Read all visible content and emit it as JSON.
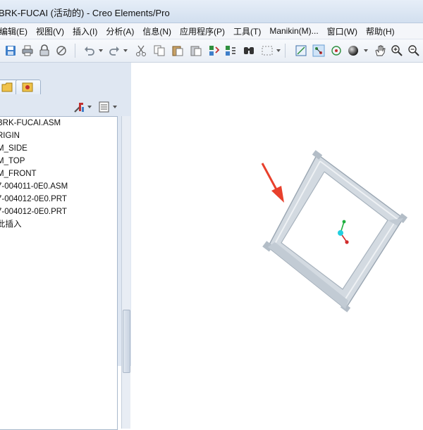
{
  "window": {
    "title": "BRK-FUCAI (活动的) - Creo Elements/Pro"
  },
  "menu": [
    "编辑(E)",
    "视图(V)",
    "插入(I)",
    "分析(A)",
    "信息(N)",
    "应用程序(P)",
    "工具(T)",
    "Manikin(M)...",
    "窗口(W)",
    "帮助(H)"
  ],
  "toolbar": {
    "icons": [
      "save-icon",
      "print-icon",
      "lock-icon",
      "disconnect-icon",
      "undo-icon",
      "redo-icon",
      "cut-icon",
      "copy-icon",
      "paste-icon",
      "paste-special-icon",
      "regenerate-icon",
      "regenerate-manager-icon",
      "find-icon",
      "select-box-icon",
      "repaint-icon",
      "spin-center-icon",
      "orient-icon",
      "shading-icon",
      "pan-hand-icon",
      "zoom-in-icon",
      "zoom-out-icon"
    ]
  },
  "model_tree": {
    "items": [
      "BRK-FUCAI.ASM",
      "RIGIN",
      "M_SIDE",
      "M_TOP",
      "M_FRONT",
      "7-004011-0E0.ASM",
      "7-004012-0E0.PRT",
      "7-004012-0E0.PRT",
      "此插入"
    ]
  },
  "colors": {
    "annotation_arrow": "#e8402c",
    "frame": "#b9c4cf",
    "csys_x": "#d12b2b",
    "csys_y": "#20b040",
    "csys_origin": "#22cfe0"
  }
}
